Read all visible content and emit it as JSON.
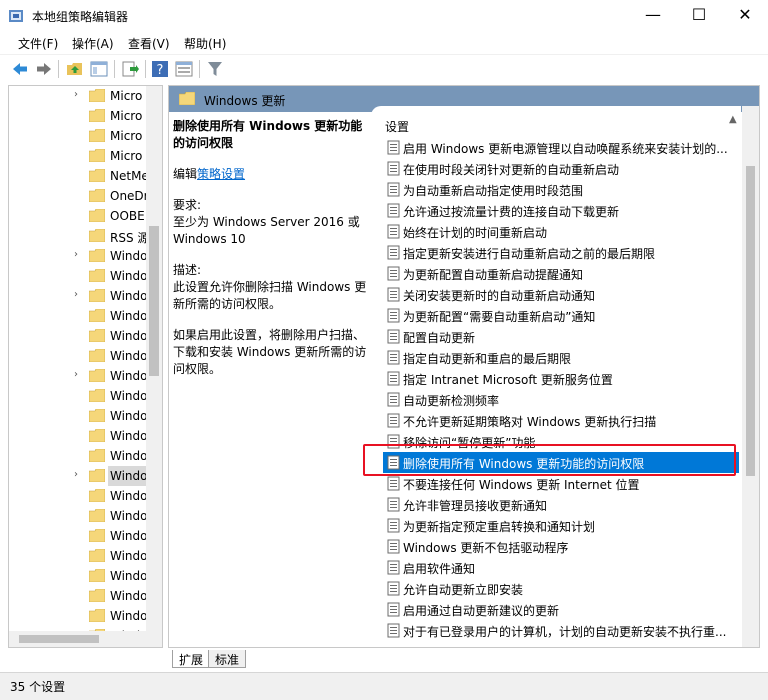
{
  "window": {
    "title": "本地组策略编辑器",
    "controls": {
      "minimize": "—",
      "maximize": "☐",
      "close": "✕"
    }
  },
  "menu": [
    {
      "label": "文件(F)"
    },
    {
      "label": "操作(A)"
    },
    {
      "label": "查看(V)"
    },
    {
      "label": "帮助(H)"
    }
  ],
  "toolbar": {
    "buttons": [
      "back-icon",
      "forward-icon",
      "up-folder-icon",
      "show-hide-tree-icon",
      "export-list-icon",
      "help-icon",
      "properties-icon",
      "filter-icon"
    ]
  },
  "tree": {
    "items": [
      {
        "label": "Micro",
        "expandable": true
      },
      {
        "label": "Micro",
        "expandable": false
      },
      {
        "label": "Micro",
        "expandable": false
      },
      {
        "label": "Micro",
        "expandable": false
      },
      {
        "label": "NetMe",
        "expandable": false
      },
      {
        "label": "OneDr",
        "expandable": false
      },
      {
        "label": "OOBE",
        "expandable": false
      },
      {
        "label": "RSS 源",
        "expandable": false
      },
      {
        "label": "Windo",
        "expandable": true
      },
      {
        "label": "Windo",
        "expandable": false
      },
      {
        "label": "Windo",
        "expandable": true
      },
      {
        "label": "Windo",
        "expandable": false
      },
      {
        "label": "Windo",
        "expandable": false
      },
      {
        "label": "Windo",
        "expandable": false
      },
      {
        "label": "Windo",
        "expandable": true
      },
      {
        "label": "Windo",
        "expandable": false
      },
      {
        "label": "Windo",
        "expandable": false
      },
      {
        "label": "Windo",
        "expandable": false
      },
      {
        "label": "Windo",
        "expandable": false
      },
      {
        "label": "Windo",
        "expandable": true
      },
      {
        "label": "Windo",
        "expandable": false
      },
      {
        "label": "Windo",
        "expandable": false
      },
      {
        "label": "Windo",
        "expandable": false
      },
      {
        "label": "Windo",
        "expandable": false
      },
      {
        "label": "Windo",
        "expandable": false
      },
      {
        "label": "Windo",
        "expandable": false
      },
      {
        "label": "Windo",
        "expandable": false
      },
      {
        "label": "Windo",
        "expandable": true
      }
    ],
    "selected_index": 19
  },
  "right_pane": {
    "header": "Windows 更新",
    "description": {
      "title": "删除使用所有 Windows 更新功能的访问权限",
      "edit_prefix": "编辑",
      "edit_link": "策略设置",
      "requirements_label": "要求:",
      "requirements_text": "至少为 Windows Server 2016 或 Windows 10",
      "description_label": "描述:",
      "description_text": "此设置允许你删除扫描 Windows 更新所需的访问权限。",
      "enabled_text": "如果启用此设置，将删除用户扫描、下载和安装 Windows 更新所需的访问权限。"
    },
    "column_header": "设置",
    "settings": [
      "启用 Windows 更新电源管理以自动唤醒系统来安装计划的...",
      "在使用时段关闭针对更新的自动重新启动",
      "为自动重新启动指定使用时段范围",
      "允许通过按流量计费的连接自动下载更新",
      "始终在计划的时间重新启动",
      "指定更新安装进行自动重新启动之前的最后期限",
      "为更新配置自动重新启动提醒通知",
      "关闭安装更新时的自动重新启动通知",
      "为更新配置“需要自动重新启动”通知",
      "配置自动更新",
      "指定自动更新和重启的最后期限",
      "指定 Intranet Microsoft 更新服务位置",
      "自动更新检测频率",
      "不允许更新延期策略对 Windows 更新执行扫描",
      "移除访问“暂停更新”功能",
      "删除使用所有 Windows 更新功能的访问权限",
      "不要连接任何 Windows 更新 Internet 位置",
      "允许非管理员接收更新通知",
      "为更新指定预定重启转换和通知计划",
      "Windows 更新不包括驱动程序",
      "启用软件通知",
      "允许自动更新立即安装",
      "启用通过自动更新建议的更新",
      "对于有已登录用户的计算机，计划的自动更新安装不执行重..."
    ],
    "selected_index": 15
  },
  "tabs": [
    {
      "label": "扩展"
    },
    {
      "label": "标准"
    }
  ],
  "status": {
    "text": "35 个设置"
  }
}
